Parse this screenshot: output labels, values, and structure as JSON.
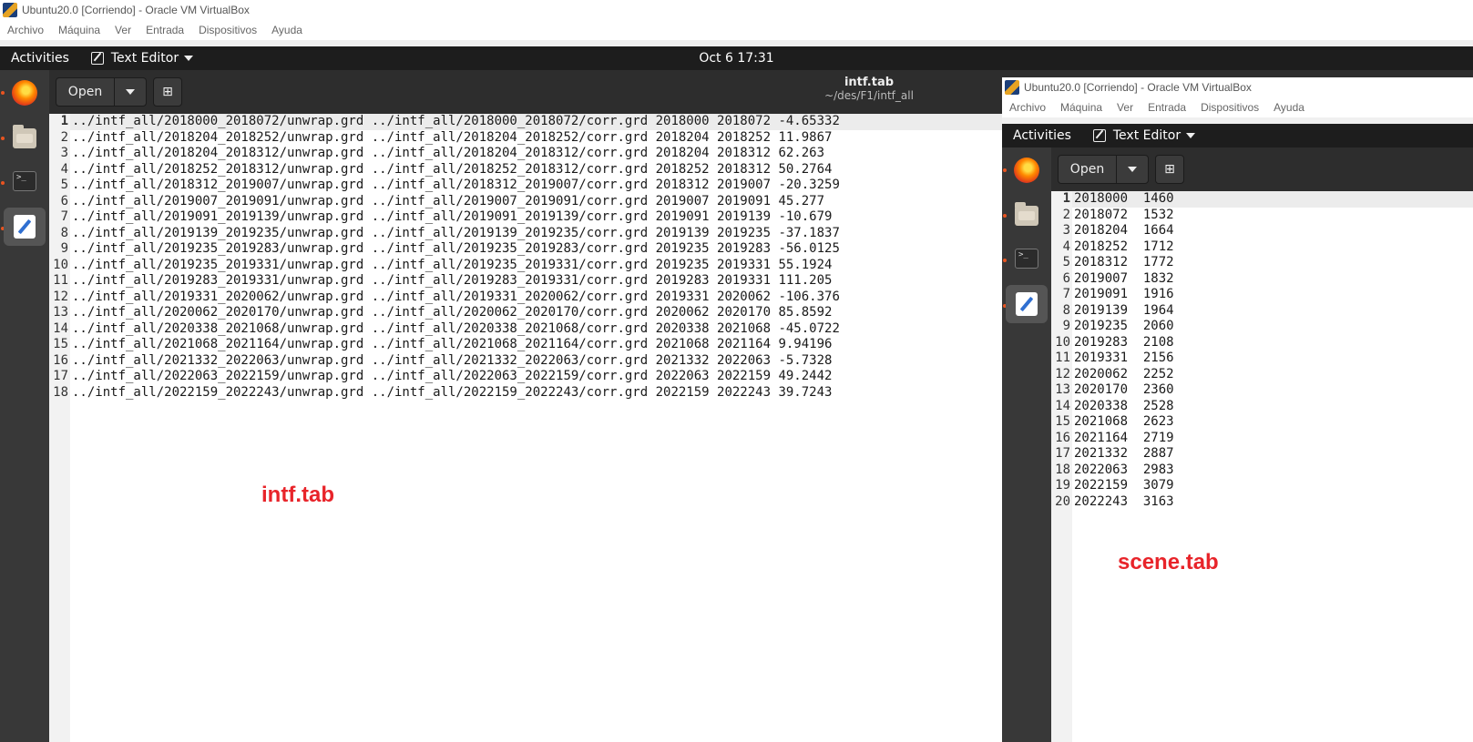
{
  "main_window": {
    "vbox_title": "Ubuntu20.0 [Corriendo] - Oracle VM VirtualBox",
    "vbox_menu": [
      "Archivo",
      "Máquina",
      "Ver",
      "Entrada",
      "Dispositivos",
      "Ayuda"
    ],
    "topbar": {
      "activities": "Activities",
      "app_name": "Text Editor",
      "clock": "Oct 6  17:31"
    },
    "dock_icons": [
      "firefox-icon",
      "files-icon",
      "terminal-icon",
      "text-editor-icon"
    ],
    "header": {
      "open_label": "Open",
      "new_tab_glyph": "⊞",
      "doc_title": "intf.tab",
      "doc_path": "~/des/F1/intf_all"
    },
    "editor": {
      "current_line": 1,
      "lines": [
        "../intf_all/2018000_2018072/unwrap.grd ../intf_all/2018000_2018072/corr.grd 2018000 2018072 -4.65332",
        "../intf_all/2018204_2018252/unwrap.grd ../intf_all/2018204_2018252/corr.grd 2018204 2018252 11.9867",
        "../intf_all/2018204_2018312/unwrap.grd ../intf_all/2018204_2018312/corr.grd 2018204 2018312 62.263",
        "../intf_all/2018252_2018312/unwrap.grd ../intf_all/2018252_2018312/corr.grd 2018252 2018312 50.2764",
        "../intf_all/2018312_2019007/unwrap.grd ../intf_all/2018312_2019007/corr.grd 2018312 2019007 -20.3259",
        "../intf_all/2019007_2019091/unwrap.grd ../intf_all/2019007_2019091/corr.grd 2019007 2019091 45.277",
        "../intf_all/2019091_2019139/unwrap.grd ../intf_all/2019091_2019139/corr.grd 2019091 2019139 -10.679",
        "../intf_all/2019139_2019235/unwrap.grd ../intf_all/2019139_2019235/corr.grd 2019139 2019235 -37.1837",
        "../intf_all/2019235_2019283/unwrap.grd ../intf_all/2019235_2019283/corr.grd 2019235 2019283 -56.0125",
        "../intf_all/2019235_2019331/unwrap.grd ../intf_all/2019235_2019331/corr.grd 2019235 2019331 55.1924",
        "../intf_all/2019283_2019331/unwrap.grd ../intf_all/2019283_2019331/corr.grd 2019283 2019331 111.205",
        "../intf_all/2019331_2020062/unwrap.grd ../intf_all/2019331_2020062/corr.grd 2019331 2020062 -106.376",
        "../intf_all/2020062_2020170/unwrap.grd ../intf_all/2020062_2020170/corr.grd 2020062 2020170 85.8592",
        "../intf_all/2020338_2021068/unwrap.grd ../intf_all/2020338_2021068/corr.grd 2020338 2021068 -45.0722",
        "../intf_all/2021068_2021164/unwrap.grd ../intf_all/2021068_2021164/corr.grd 2021068 2021164 9.94196",
        "../intf_all/2021332_2022063/unwrap.grd ../intf_all/2021332_2022063/corr.grd 2021332 2022063 -5.7328",
        "../intf_all/2022063_2022159/unwrap.grd ../intf_all/2022063_2022159/corr.grd 2022063 2022159 49.2442",
        "../intf_all/2022159_2022243/unwrap.grd ../intf_all/2022159_2022243/corr.grd 2022159 2022243 39.7243"
      ]
    },
    "annotation": "intf.tab"
  },
  "second_window": {
    "vbox_title": "Ubuntu20.0 [Corriendo] - Oracle VM VirtualBox",
    "vbox_menu": [
      "Archivo",
      "Máquina",
      "Ver",
      "Entrada",
      "Dispositivos",
      "Ayuda"
    ],
    "topbar": {
      "activities": "Activities",
      "app_name": "Text Editor"
    },
    "header": {
      "open_label": "Open",
      "new_tab_glyph": "⊞"
    },
    "editor": {
      "current_line": 1,
      "lines": [
        "2018000  1460",
        "2018072  1532",
        "2018204  1664",
        "2018252  1712",
        "2018312  1772",
        "2019007  1832",
        "2019091  1916",
        "2019139  1964",
        "2019235  2060",
        "2019283  2108",
        "2019331  2156",
        "2020062  2252",
        "2020170  2360",
        "2020338  2528",
        "2021068  2623",
        "2021164  2719",
        "2021332  2887",
        "2022063  2983",
        "2022159  3079",
        "2022243  3163"
      ]
    },
    "annotation": "scene.tab"
  }
}
